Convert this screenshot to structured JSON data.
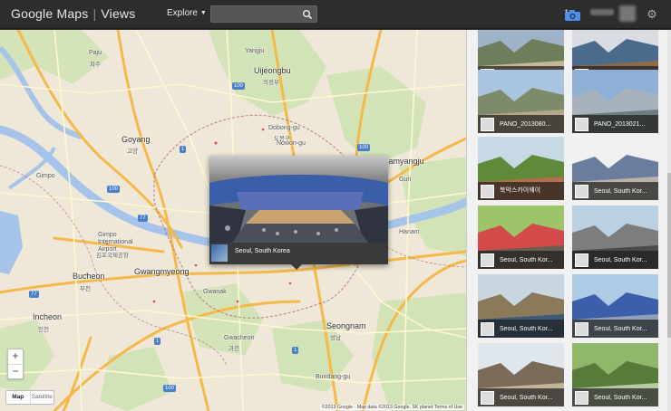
{
  "header": {
    "brand_google": "Google",
    "brand_maps": "Maps",
    "brand_separator": "|",
    "brand_views": "Views",
    "explore_label": "Explore",
    "search_placeholder": ""
  },
  "map": {
    "places": [
      {
        "text": "Paju"
      },
      {
        "text": "파주"
      },
      {
        "text": "Yangju"
      },
      {
        "text": "Uijeongbu"
      },
      {
        "text": "의정부"
      },
      {
        "text": "Goyang"
      },
      {
        "text": "고양"
      },
      {
        "text": "Dobong-gu"
      },
      {
        "text": "도봉구"
      },
      {
        "text": "Nowon-gu"
      },
      {
        "text": "Namyangju"
      },
      {
        "text": "Gimpo"
      },
      {
        "text": "Gimpo International Airport"
      },
      {
        "text": "김포국제공항"
      },
      {
        "text": "Bucheon"
      },
      {
        "text": "부천"
      },
      {
        "text": "Gwangmyeong"
      },
      {
        "text": "Incheon"
      },
      {
        "text": "인천"
      },
      {
        "text": "Gwacheon"
      },
      {
        "text": "과천"
      },
      {
        "text": "Seongnam"
      },
      {
        "text": "성남"
      },
      {
        "text": "Gwanak"
      },
      {
        "text": "Bundang-gu"
      },
      {
        "text": "Hanam"
      },
      {
        "text": "Guri"
      }
    ],
    "routes": [
      "77",
      "100",
      "1",
      "100",
      "77",
      "1",
      "100",
      "100",
      "1"
    ],
    "zoom_in": "+",
    "zoom_out": "−",
    "map_type_map": "Map",
    "map_type_satellite": "Satellite",
    "attribution": "©2013 Google - Map data ©2013 Google, SK planet  Terms of Use"
  },
  "popup": {
    "caption": "Seoul, South Korea"
  },
  "photos": [
    {
      "label": "Seoul, South Kor..."
    },
    {
      "label": "PANO_2013070..."
    },
    {
      "label": "PANO_2013080..."
    },
    {
      "label": "PANO_2013021..."
    },
    {
      "label": "북악스카이웨이"
    },
    {
      "label": "Seoul, South Kor..."
    },
    {
      "label": "Seoul, South Kor..."
    },
    {
      "label": "Seoul, South Kor..."
    },
    {
      "label": "Seoul, South Kor..."
    },
    {
      "label": "Seoul, South Kor..."
    },
    {
      "label": "Seoul, South Kor..."
    },
    {
      "label": "Seoul, South Kor..."
    }
  ],
  "colors": {
    "topbar": "#2d2d2d",
    "map_land": "#efe8d8",
    "river": "#a6c3e9",
    "highway": "#f5b94a",
    "arterial": "#ffffff"
  }
}
